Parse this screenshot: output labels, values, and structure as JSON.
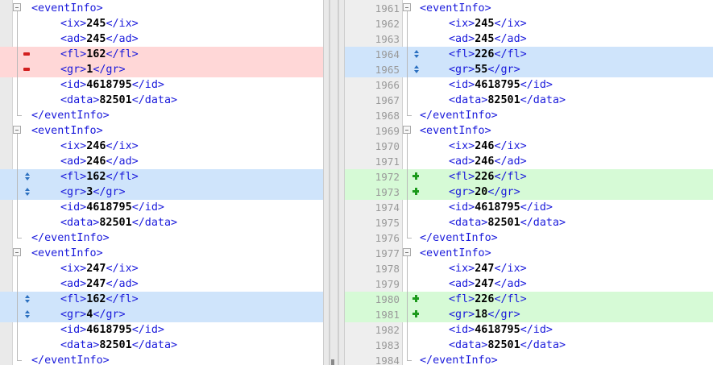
{
  "left_pane": {
    "rows": [
      {
        "code": "<eventInfo>",
        "status": "same",
        "fold": "open"
      },
      {
        "code": "<ix>245</ix>",
        "status": "same",
        "fold": "line"
      },
      {
        "code": "<ad>245</ad>",
        "status": "same",
        "fold": "line"
      },
      {
        "code": "<fl>162</fl>",
        "status": "del",
        "fold": "line"
      },
      {
        "code": "<gr>1</gr>",
        "status": "del",
        "fold": "line"
      },
      {
        "code": "<id>4618795</id>",
        "status": "same",
        "fold": "line"
      },
      {
        "code": "<data>82501</data>",
        "status": "same",
        "fold": "line"
      },
      {
        "code": "</eventInfo>",
        "status": "same",
        "fold": "close"
      },
      {
        "code": "<eventInfo>",
        "status": "same",
        "fold": "open"
      },
      {
        "code": "<ix>246</ix>",
        "status": "same",
        "fold": "line"
      },
      {
        "code": "<ad>246</ad>",
        "status": "same",
        "fold": "line"
      },
      {
        "code": "<fl>162</fl>",
        "status": "chg",
        "fold": "line"
      },
      {
        "code": "<gr>3</gr>",
        "status": "chg",
        "fold": "line"
      },
      {
        "code": "<id>4618795</id>",
        "status": "same",
        "fold": "line"
      },
      {
        "code": "<data>82501</data>",
        "status": "same",
        "fold": "line"
      },
      {
        "code": "</eventInfo>",
        "status": "same",
        "fold": "close"
      },
      {
        "code": "<eventInfo>",
        "status": "same",
        "fold": "open"
      },
      {
        "code": "<ix>247</ix>",
        "status": "same",
        "fold": "line"
      },
      {
        "code": "<ad>247</ad>",
        "status": "same",
        "fold": "line"
      },
      {
        "code": "<fl>162</fl>",
        "status": "chg",
        "fold": "line"
      },
      {
        "code": "<gr>4</gr>",
        "status": "chg",
        "fold": "line"
      },
      {
        "code": "<id>4618795</id>",
        "status": "same",
        "fold": "line"
      },
      {
        "code": "<data>82501</data>",
        "status": "same",
        "fold": "line"
      },
      {
        "code": "</eventInfo>",
        "status": "same",
        "fold": "close"
      }
    ]
  },
  "right_pane": {
    "rows": [
      {
        "line": "1961",
        "code": "<eventInfo>",
        "status": "same",
        "fold": "open"
      },
      {
        "line": "1962",
        "code": "<ix>245</ix>",
        "status": "same",
        "fold": "line"
      },
      {
        "line": "1963",
        "code": "<ad>245</ad>",
        "status": "same",
        "fold": "line"
      },
      {
        "line": "1964",
        "code": "<fl>226</fl>",
        "status": "chg",
        "fold": "line"
      },
      {
        "line": "1965",
        "code": "<gr>55</gr>",
        "status": "chg",
        "fold": "line"
      },
      {
        "line": "1966",
        "code": "<id>4618795</id>",
        "status": "same",
        "fold": "line"
      },
      {
        "line": "1967",
        "code": "<data>82501</data>",
        "status": "same",
        "fold": "line"
      },
      {
        "line": "1968",
        "code": "</eventInfo>",
        "status": "same",
        "fold": "close"
      },
      {
        "line": "1969",
        "code": "<eventInfo>",
        "status": "same",
        "fold": "open"
      },
      {
        "line": "1970",
        "code": "<ix>246</ix>",
        "status": "same",
        "fold": "line"
      },
      {
        "line": "1971",
        "code": "<ad>246</ad>",
        "status": "same",
        "fold": "line"
      },
      {
        "line": "1972",
        "code": "<fl>226</fl>",
        "status": "add",
        "fold": "line"
      },
      {
        "line": "1973",
        "code": "<gr>20</gr>",
        "status": "add",
        "fold": "line"
      },
      {
        "line": "1974",
        "code": "<id>4618795</id>",
        "status": "same",
        "fold": "line"
      },
      {
        "line": "1975",
        "code": "<data>82501</data>",
        "status": "same",
        "fold": "line"
      },
      {
        "line": "1976",
        "code": "</eventInfo>",
        "status": "same",
        "fold": "close"
      },
      {
        "line": "1977",
        "code": "<eventInfo>",
        "status": "same",
        "fold": "open"
      },
      {
        "line": "1978",
        "code": "<ix>247</ix>",
        "status": "same",
        "fold": "line"
      },
      {
        "line": "1979",
        "code": "<ad>247</ad>",
        "status": "same",
        "fold": "line"
      },
      {
        "line": "1980",
        "code": "<fl>226</fl>",
        "status": "add",
        "fold": "line"
      },
      {
        "line": "1981",
        "code": "<gr>18</gr>",
        "status": "add",
        "fold": "line"
      },
      {
        "line": "1982",
        "code": "<id>4618795</id>",
        "status": "same",
        "fold": "line"
      },
      {
        "line": "1983",
        "code": "<data>82501</data>",
        "status": "same",
        "fold": "line"
      },
      {
        "line": "1984",
        "code": "</eventInfo>",
        "status": "same",
        "fold": "close"
      }
    ]
  },
  "colors": {
    "tag": "#1a1adb",
    "value": "#000000",
    "deleted_bg": "#ffd7d7",
    "changed_bg": "#cfe4fb",
    "added_bg": "#d6fad6",
    "line_number": "#999999"
  },
  "icons": {
    "deleted": "minus-icon",
    "changed": "updown-arrows-icon",
    "added": "plus-icon",
    "fold_open": "fold-collapse-icon"
  }
}
